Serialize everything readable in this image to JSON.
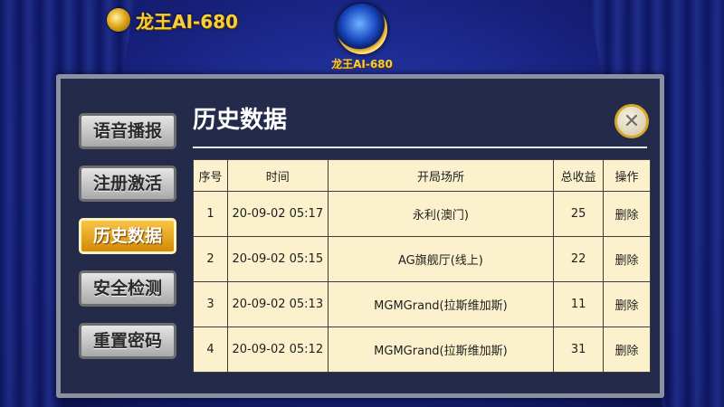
{
  "header": {
    "brand": "龙王AI-680",
    "logo_caption": "龙王AI-680"
  },
  "sidebar": {
    "items": [
      {
        "label": "语音播报"
      },
      {
        "label": "注册激活"
      },
      {
        "label": "历史数据",
        "active": true
      },
      {
        "label": "安全检测"
      },
      {
        "label": "重置密码"
      }
    ]
  },
  "main": {
    "title": "历史数据",
    "close_icon": "close-icon"
  },
  "table": {
    "columns": [
      "序号",
      "时间",
      "开局场所",
      "总收益",
      "操作"
    ],
    "rows": [
      {
        "index": "1",
        "time": "20-09-02 05:17",
        "venue": "永利(澳门)",
        "total": "25",
        "action": "删除"
      },
      {
        "index": "2",
        "time": "20-09-02 05:15",
        "venue": "AG旗舰厅(线上)",
        "total": "22",
        "action": "删除"
      },
      {
        "index": "3",
        "time": "20-09-02 05:13",
        "venue": "MGMGrand(拉斯维加斯)",
        "total": "11",
        "action": "删除"
      },
      {
        "index": "4",
        "time": "20-09-02 05:12",
        "venue": "MGMGrand(拉斯维加斯)",
        "total": "31",
        "action": "删除"
      }
    ]
  },
  "colors": {
    "accent": "#f0a820",
    "panel": "#242a4a",
    "table_bg": "#fbf1cc"
  }
}
